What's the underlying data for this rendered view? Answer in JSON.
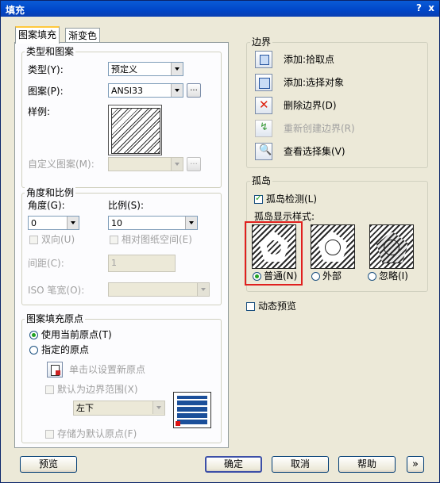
{
  "window": {
    "title": "填充",
    "help_glyph": "?",
    "close_glyph": "x"
  },
  "tabs": [
    {
      "label": "图案填充"
    },
    {
      "label": "渐变色"
    }
  ],
  "type_pattern": {
    "group_label": "类型和图案",
    "type_label": "类型(Y):",
    "type_value": "预定义",
    "pattern_label": "图案(P):",
    "pattern_value": "ANSI33",
    "browse_glyph": "...",
    "swatch_label": "样例:",
    "custom_label": "自定义图案(M):",
    "custom_browse_glyph": "..."
  },
  "angle_scale": {
    "group_label": "角度和比例",
    "angle_label": "角度(G):",
    "angle_value": "0",
    "scale_label": "比例(S):",
    "scale_value": "10",
    "double_label": "双向(U)",
    "relative_label": "相对图纸空间(E)",
    "spacing_label": "间距(C):",
    "spacing_value": "1",
    "iso_label": "ISO 笔宽(O):"
  },
  "origin": {
    "group_label": "图案填充原点",
    "use_current": "使用当前原点(T)",
    "specified": "指定的原点",
    "click_set": "单击以设置新原点",
    "default_extent": "默认为边界范围(X)",
    "position_value": "左下",
    "store_default": "存储为默认原点(F)"
  },
  "boundaries": {
    "group_label": "边界",
    "items": [
      {
        "label": "添加:拾取点",
        "icon": "pick-point-icon",
        "enabled": true
      },
      {
        "label": "添加:选择对象",
        "icon": "select-objects-icon",
        "enabled": true
      },
      {
        "label": "删除边界(D)",
        "icon": "remove-boundaries-icon",
        "enabled": true
      },
      {
        "label": "重新创建边界(R)",
        "icon": "recreate-boundary-icon",
        "enabled": false
      },
      {
        "label": "查看选择集(V)",
        "icon": "view-selections-icon",
        "enabled": true
      }
    ]
  },
  "islands": {
    "group_label": "孤岛",
    "detect_label": "孤岛检测(L)",
    "style_label": "孤岛显示样式:",
    "styles": [
      {
        "label": "普通(N)",
        "selected": true
      },
      {
        "label": "外部",
        "selected": false
      },
      {
        "label": "忽略(I)",
        "selected": false
      }
    ],
    "highlight_color": "#e0201e"
  },
  "dynamic_preview_label": "动态预览",
  "footer": {
    "preview": "预览",
    "ok": "确定",
    "cancel": "取消",
    "help": "帮助",
    "more": "»"
  }
}
